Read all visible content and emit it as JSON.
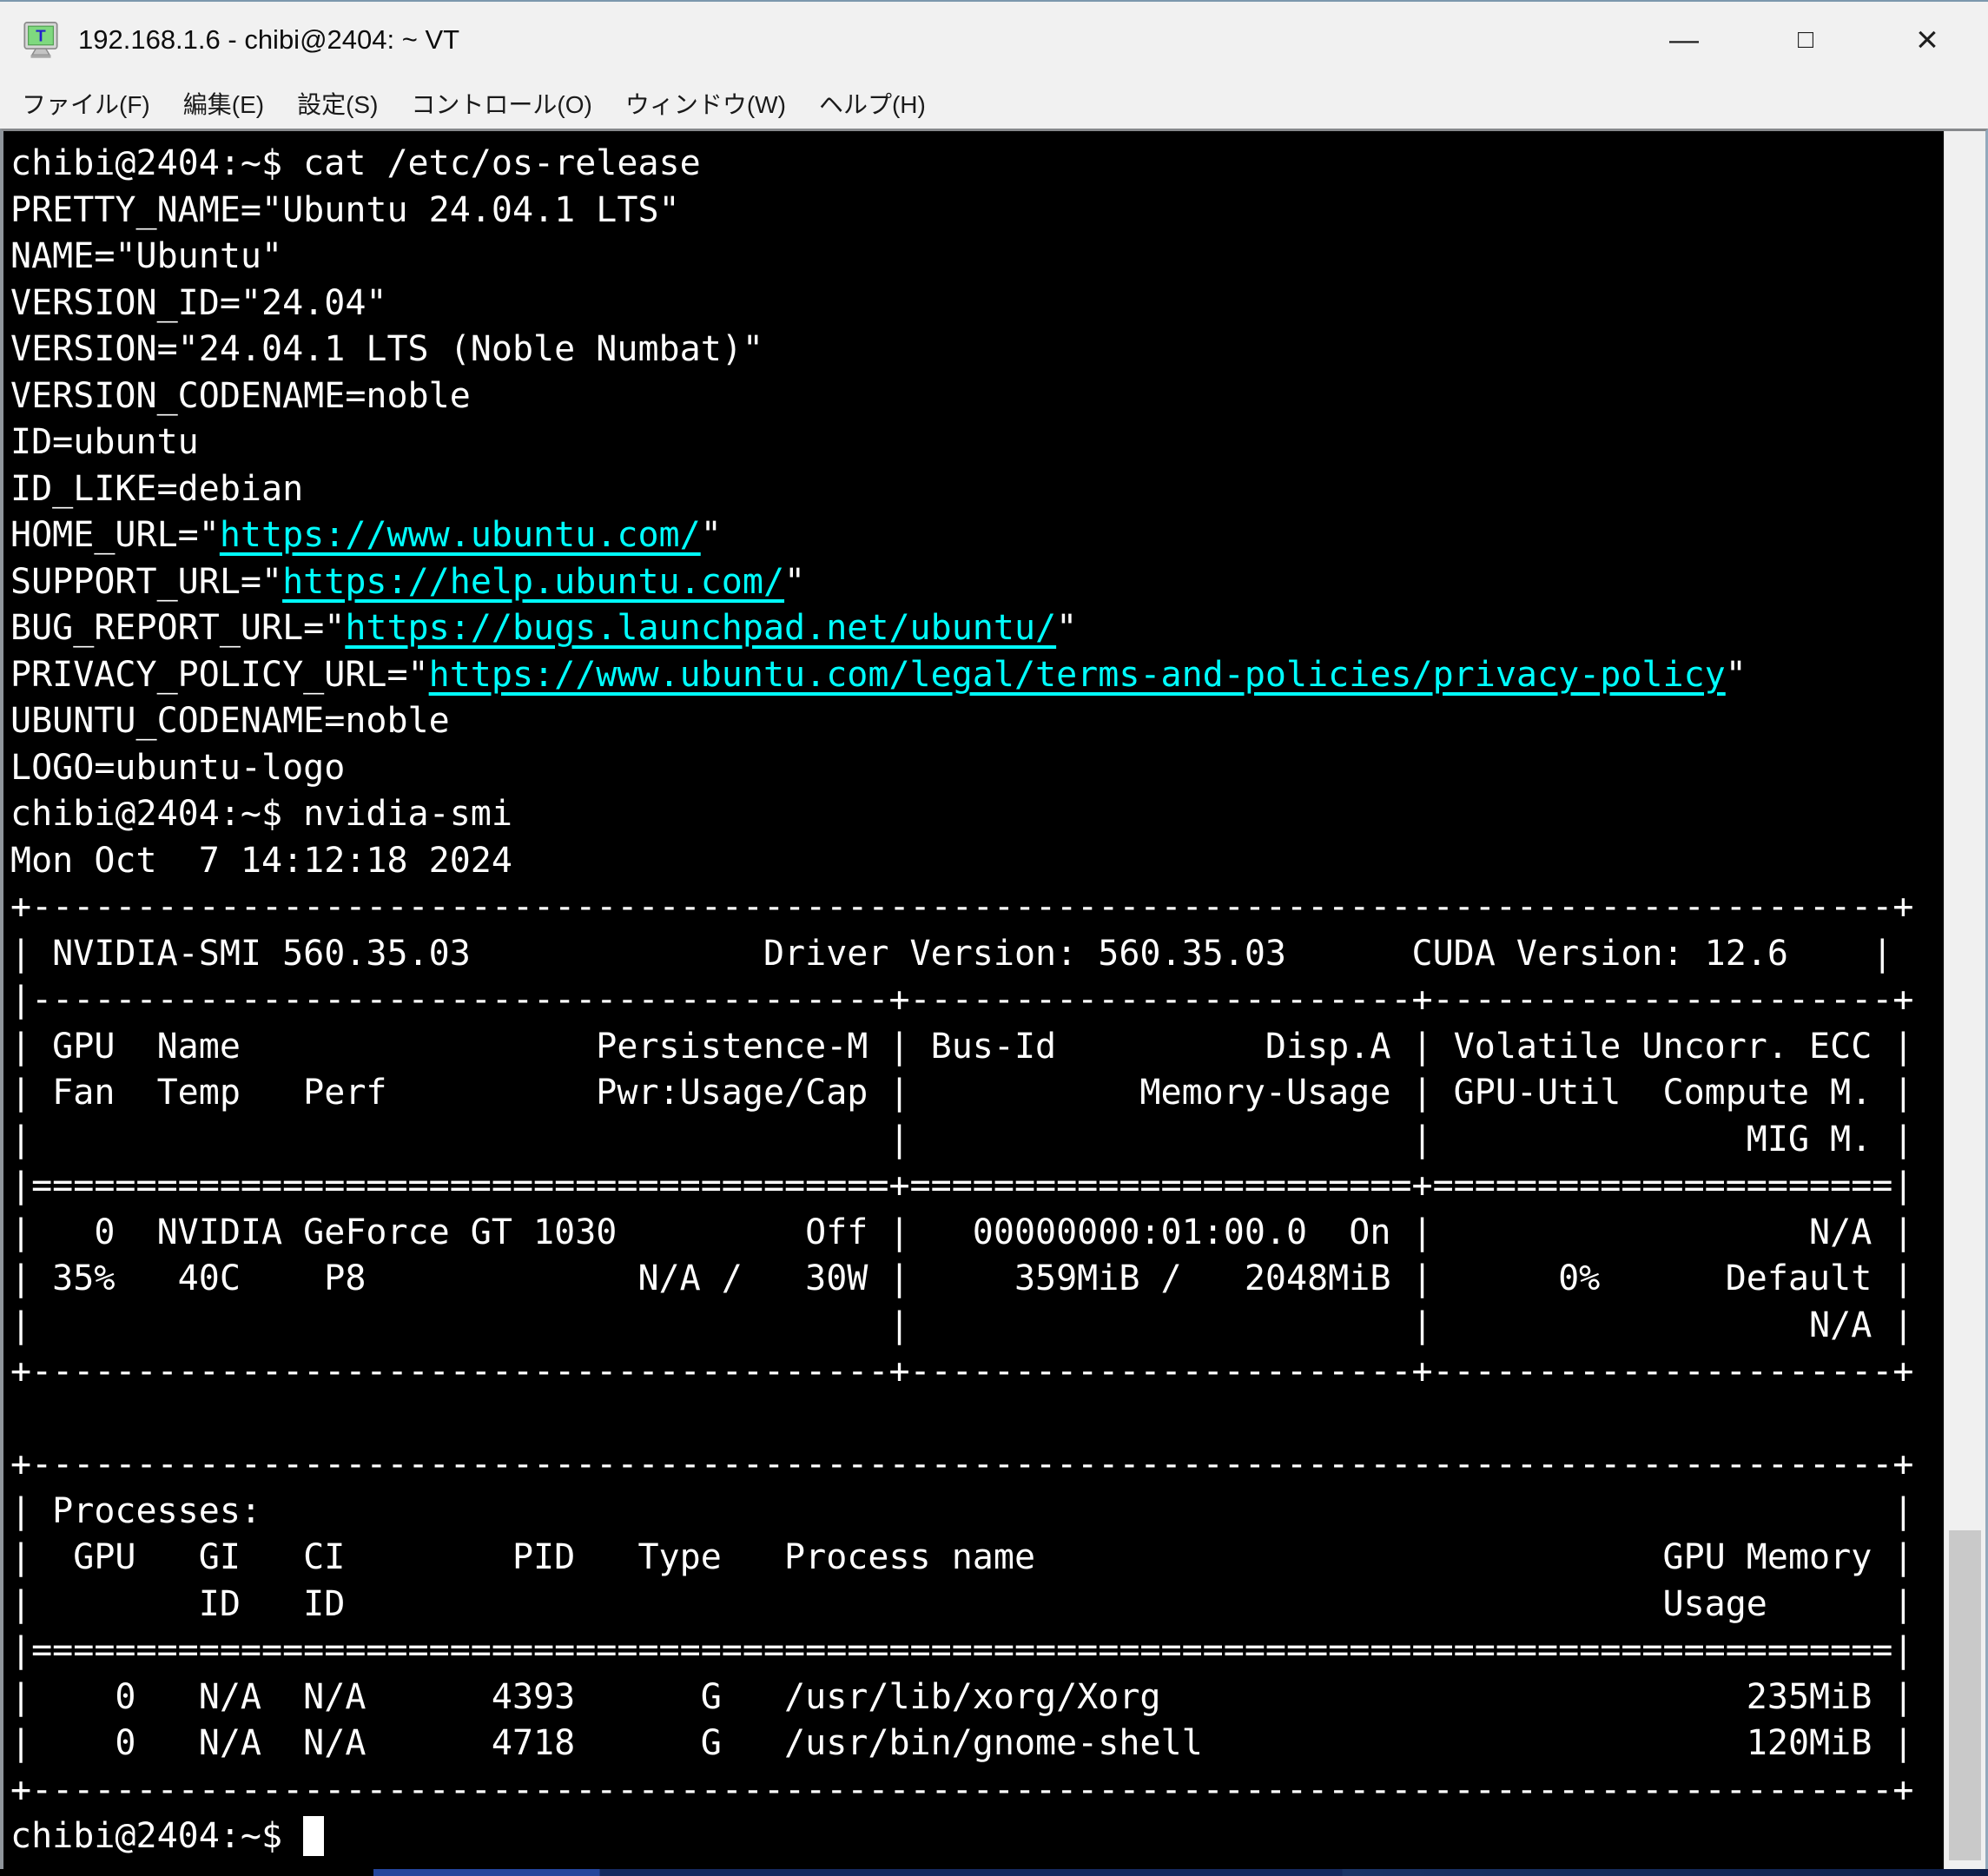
{
  "window": {
    "title": "192.168.1.6 - chibi@2404: ~ VT"
  },
  "icons": {
    "minimize": "—",
    "maximize": "□",
    "close": "×"
  },
  "menu_bar": {
    "items": [
      {
        "label": "ファイル(F)"
      },
      {
        "label": "編集(E)"
      },
      {
        "label": "設定(S)"
      },
      {
        "label": "コントロール(O)"
      },
      {
        "label": "ウィンドウ(W)"
      },
      {
        "label": "ヘルプ(H)"
      }
    ]
  },
  "terminal": {
    "colors": {
      "background": "#000000",
      "foreground": "#ffffff",
      "link": "#00ffff"
    },
    "prompt": "chibi@2404:~$",
    "gpu_summary": {
      "driver_version": "560.35.03",
      "cuda_version": "12.6",
      "gpu_name": "NVIDIA GeForce GT 1030",
      "fan": "35%",
      "temp": "40C",
      "perf": "P8",
      "power": "N/A / 30W",
      "bus_id": "00000000:01:00.0",
      "memory": "359MiB / 2048MiB",
      "gpu_util": "0%",
      "compute_mode": "Default",
      "processes": [
        {
          "pid": "4393",
          "type": "G",
          "name": "/usr/lib/xorg/Xorg",
          "gpu_memory": "235MiB"
        },
        {
          "pid": "4718",
          "type": "G",
          "name": "/usr/bin/gnome-shell",
          "gpu_memory": "120MiB"
        }
      ]
    },
    "lines": [
      [
        {
          "t": "chibi@2404:~$ cat /etc/os-release"
        }
      ],
      [
        {
          "t": "PRETTY_NAME=\"Ubuntu 24.04.1 LTS\""
        }
      ],
      [
        {
          "t": "NAME=\"Ubuntu\""
        }
      ],
      [
        {
          "t": "VERSION_ID=\"24.04\""
        }
      ],
      [
        {
          "t": "VERSION=\"24.04.1 LTS (Noble Numbat)\""
        }
      ],
      [
        {
          "t": "VERSION_CODENAME=noble"
        }
      ],
      [
        {
          "t": "ID=ubuntu"
        }
      ],
      [
        {
          "t": "ID_LIKE=debian"
        }
      ],
      [
        {
          "t": "HOME_URL=\""
        },
        {
          "t": "https://www.ubuntu.com/",
          "link": true
        },
        {
          "t": "\""
        }
      ],
      [
        {
          "t": "SUPPORT_URL=\""
        },
        {
          "t": "https://help.ubuntu.com/",
          "link": true
        },
        {
          "t": "\""
        }
      ],
      [
        {
          "t": "BUG_REPORT_URL=\""
        },
        {
          "t": "https://bugs.launchpad.net/ubuntu/",
          "link": true
        },
        {
          "t": "\""
        }
      ],
      [
        {
          "t": "PRIVACY_POLICY_URL=\""
        },
        {
          "t": "https://www.ubuntu.com/legal/terms-and-policies/privacy-policy",
          "link": true
        },
        {
          "t": "\""
        }
      ],
      [
        {
          "t": "UBUNTU_CODENAME=noble"
        }
      ],
      [
        {
          "t": "LOGO=ubuntu-logo"
        }
      ],
      [
        {
          "t": "chibi@2404:~$ nvidia-smi"
        }
      ],
      [
        {
          "t": "Mon Oct  7 14:12:18 2024"
        }
      ],
      [
        {
          "t": "+-----------------------------------------------------------------------------------------+"
        }
      ],
      [
        {
          "t": "| NVIDIA-SMI 560.35.03              Driver Version: 560.35.03      CUDA Version: 12.6    |"
        }
      ],
      [
        {
          "t": "|-----------------------------------------+------------------------+----------------------+"
        }
      ],
      [
        {
          "t": "| GPU  Name                 Persistence-M | Bus-Id          Disp.A | Volatile Uncorr. ECC |"
        }
      ],
      [
        {
          "t": "| Fan  Temp   Perf          Pwr:Usage/Cap |           Memory-Usage | GPU-Util  Compute M. |"
        }
      ],
      [
        {
          "t": "|                                         |                        |               MIG M. |"
        }
      ],
      [
        {
          "t": "|=========================================+========================+======================|"
        }
      ],
      [
        {
          "t": "|   0  NVIDIA GeForce GT 1030         Off |   00000000:01:00.0  On |                  N/A |"
        }
      ],
      [
        {
          "t": "| 35%   40C    P8             N/A /   30W |     359MiB /   2048MiB |      0%      Default |"
        }
      ],
      [
        {
          "t": "|                                         |                        |                  N/A |"
        }
      ],
      [
        {
          "t": "+-----------------------------------------+------------------------+----------------------+"
        }
      ],
      [],
      [
        {
          "t": "+-----------------------------------------------------------------------------------------+"
        }
      ],
      [
        {
          "t": "| Processes:                                                                              |"
        }
      ],
      [
        {
          "t": "|  GPU   GI   CI        PID   Type   Process name                              GPU Memory |"
        }
      ],
      [
        {
          "t": "|        ID   ID                                                               Usage      |"
        }
      ],
      [
        {
          "t": "|=========================================================================================|"
        }
      ],
      [
        {
          "t": "|    0   N/A  N/A      4393      G   /usr/lib/xorg/Xorg                            235MiB |"
        }
      ],
      [
        {
          "t": "|    0   N/A  N/A      4718      G   /usr/bin/gnome-shell                          120MiB |"
        }
      ],
      [
        {
          "t": "+-----------------------------------------------------------------------------------------+"
        }
      ],
      [
        {
          "t": "chibi@2404:~$ "
        },
        {
          "cursor": true
        }
      ]
    ]
  }
}
